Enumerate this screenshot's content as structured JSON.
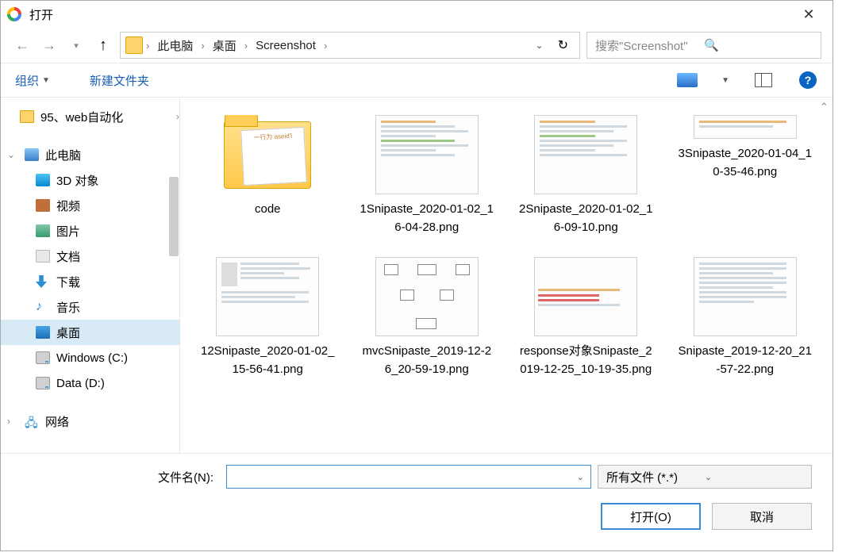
{
  "title": "打开",
  "breadcrumbs": [
    "此电脑",
    "桌面",
    "Screenshot"
  ],
  "search_placeholder": "搜索\"Screenshot\"",
  "toolbar": {
    "organize": "组织",
    "new_folder": "新建文件夹"
  },
  "tree": {
    "quick": "95、web自动化",
    "this_pc": "此电脑",
    "items": [
      "3D 对象",
      "视频",
      "图片",
      "文档",
      "下载",
      "音乐",
      "桌面",
      "Windows (C:)",
      "Data (D:)"
    ],
    "network": "网络"
  },
  "files": [
    {
      "name": "code",
      "type": "folder"
    },
    {
      "name": "1Snipaste_2020-01-02_16-04-28.png",
      "type": "img"
    },
    {
      "name": "2Snipaste_2020-01-02_16-09-10.png",
      "type": "img"
    },
    {
      "name": "3Snipaste_2020-01-04_10-35-46.png",
      "type": "img"
    },
    {
      "name": "12Snipaste_2020-01-02_15-56-41.png",
      "type": "img"
    },
    {
      "name": "mvcSnipaste_2019-12-26_20-59-19.png",
      "type": "img"
    },
    {
      "name": "response对象Snipaste_2019-12-25_10-19-35.png",
      "type": "img"
    },
    {
      "name": "Snipaste_2019-12-20_21-57-22.png",
      "type": "img"
    }
  ],
  "filename_label": "文件名(N):",
  "filter_label": "所有文件 (*.*)",
  "open_btn": "打开(O)",
  "cancel_btn": "取消",
  "folder_inner": "一行为\naseid'l"
}
